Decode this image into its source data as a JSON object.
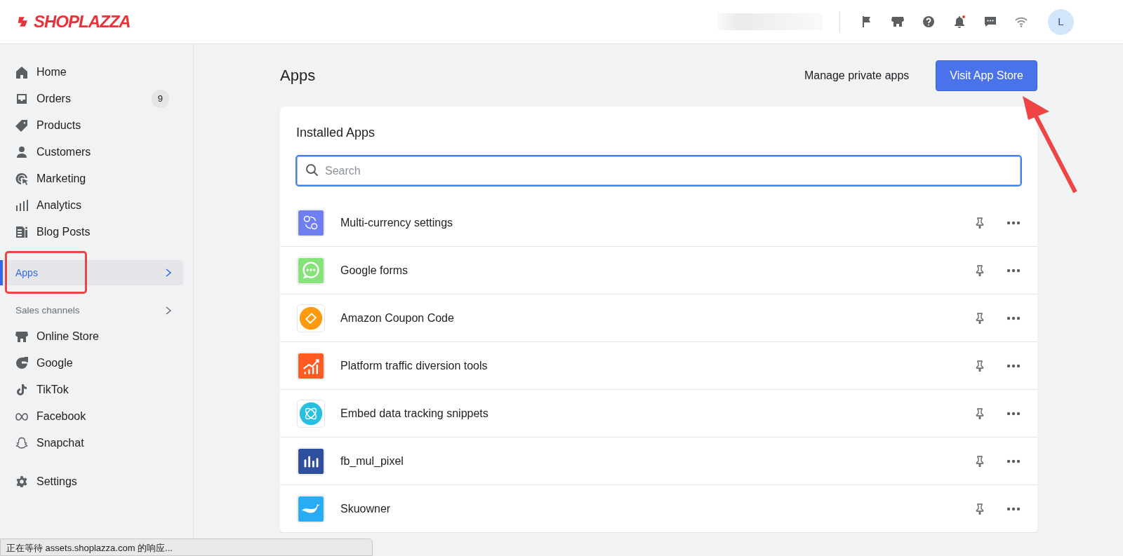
{
  "header": {
    "logo": "SHOPLAZZA",
    "store_name_redacted": true,
    "notification_unread": true,
    "avatar_initial": "L"
  },
  "sidebar": {
    "items": [
      {
        "kind": "nav",
        "label": "Home",
        "selected": false
      },
      {
        "kind": "nav",
        "label": "Orders",
        "badge": "9",
        "selected": false
      },
      {
        "kind": "nav",
        "label": "Products",
        "selected": false
      },
      {
        "kind": "nav",
        "label": "Customers",
        "selected": false
      },
      {
        "kind": "nav",
        "label": "Marketing",
        "selected": false
      },
      {
        "kind": "nav",
        "label": "Analytics",
        "selected": false
      },
      {
        "kind": "nav",
        "label": "Blog Posts",
        "selected": false
      },
      {
        "kind": "nav",
        "label": "Apps",
        "selected": true,
        "chevron": true
      },
      {
        "kind": "section",
        "label": "Sales channels",
        "chevron": true
      },
      {
        "kind": "nav",
        "label": "Online Store",
        "selected": false
      },
      {
        "kind": "nav",
        "label": "Google",
        "selected": false
      },
      {
        "kind": "nav",
        "label": "TikTok",
        "selected": false
      },
      {
        "kind": "nav",
        "label": "Facebook",
        "selected": false
      },
      {
        "kind": "nav",
        "label": "Snapchat",
        "selected": false
      },
      {
        "kind": "nav",
        "label": "Settings",
        "selected": false
      }
    ]
  },
  "page": {
    "title": "Apps",
    "secondary_action": "Manage private apps",
    "primary_action": "Visit App Store"
  },
  "installed_apps": {
    "title": "Installed Apps",
    "search": {
      "placeholder": "Search"
    },
    "apps": [
      {
        "name": "Multi-currency settings",
        "color": "#6f7ef0"
      },
      {
        "name": "Google forms",
        "color": "#86e37a"
      },
      {
        "name": "Amazon Coupon Code",
        "color": "#ff9a0e"
      },
      {
        "name": "Platform traffic diversion tools",
        "color": "#ff5a22"
      },
      {
        "name": "Embed data tracking snippets",
        "color": "#27c0e0"
      },
      {
        "name": "fb_mul_pixel",
        "color": "#2e4f9e"
      },
      {
        "name": "Skuowner",
        "color": "#28adf5"
      }
    ]
  },
  "annotations": [
    {
      "kind": "highlight-box"
    },
    {
      "kind": "arrow"
    }
  ],
  "status_bar": "正在等待 assets.shoplazza.com 的响应..."
}
